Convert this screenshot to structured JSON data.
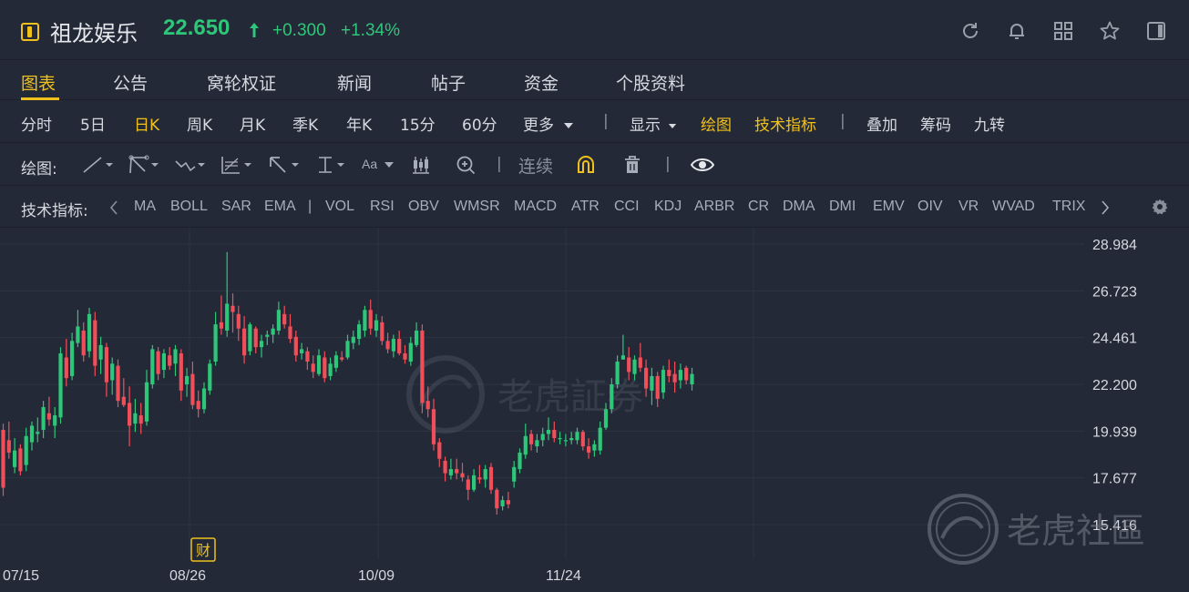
{
  "header": {
    "stock_name": "祖龙娱乐",
    "price": "22.650",
    "change": "+0.300",
    "change_pct": "+1.34%",
    "up_color": "#2ec77a",
    "down_color": "#f04f59",
    "accent": "#f0c11b",
    "icons": [
      "refresh-icon",
      "bell-icon",
      "grid-icon",
      "star-icon",
      "sidebar-icon"
    ]
  },
  "tabs": [
    {
      "label": "图表",
      "active": true
    },
    {
      "label": "公告",
      "active": false
    },
    {
      "label": "窝轮权证",
      "active": false
    },
    {
      "label": "新闻",
      "active": false
    },
    {
      "label": "帖子",
      "active": false
    },
    {
      "label": "资金",
      "active": false
    },
    {
      "label": "个股资料",
      "active": false
    }
  ],
  "periods": {
    "items": [
      "分时",
      "5日",
      "日K",
      "周K",
      "月K",
      "季K",
      "年K",
      "15分",
      "60分"
    ],
    "active": "日K",
    "more": "更多",
    "display": "显示",
    "draw": "绘图",
    "tech": "技术指标",
    "overlay": "叠加",
    "chips": "筹码",
    "nine": "九转"
  },
  "drawing": {
    "label": "绘图:",
    "continuous": "连续",
    "tools": [
      "line-tool-icon",
      "channel-tool-icon",
      "wave-tool-icon",
      "fib-tool-icon",
      "arrow-tool-icon",
      "measure-tool-icon",
      "text-tool-icon",
      "candle-tool-icon",
      "zoom-in-icon",
      "magnet-icon",
      "trash-icon",
      "eye-icon"
    ],
    "text_tool": "Aa"
  },
  "indicators": {
    "label": "技术指标:",
    "main": [
      "MA",
      "BOLL",
      "SAR",
      "EMA"
    ],
    "sub": [
      "VOL",
      "RSI",
      "OBV",
      "WMSR",
      "MACD",
      "ATR",
      "CCI",
      "KDJ",
      "ARBR",
      "CR",
      "DMA",
      "DMI",
      "EMV",
      "OIV",
      "VR",
      "WVAD",
      "TRIX"
    ],
    "icons": [
      "chevron-left-icon",
      "chevron-right-icon",
      "settings-icon"
    ]
  },
  "chart_data": {
    "type": "candlestick",
    "y_ticks": [
      "28.984",
      "26.723",
      "24.461",
      "22.200",
      "19.939",
      "17.677",
      "15.416"
    ],
    "ylim": [
      15.416,
      28.984
    ],
    "x_ticks": [
      "07/15",
      "08/26",
      "10/09",
      "11/24"
    ],
    "earnings_marker": "财",
    "watermark_center": "老虎証券",
    "watermark_corner": "老虎社區",
    "ohlc": [
      [
        20.0,
        20.3,
        16.8,
        17.2
      ],
      [
        19.5,
        20.4,
        18.6,
        18.9
      ],
      [
        18.2,
        19.6,
        17.9,
        19.0
      ],
      [
        19.1,
        19.3,
        17.8,
        18.0
      ],
      [
        18.3,
        20.1,
        18.0,
        19.7
      ],
      [
        19.4,
        20.4,
        19.0,
        20.2
      ],
      [
        19.8,
        20.6,
        19.4,
        19.9
      ],
      [
        20.0,
        21.4,
        19.6,
        21.1
      ],
      [
        20.8,
        21.6,
        20.2,
        20.5
      ],
      [
        20.2,
        21.1,
        19.6,
        20.7
      ],
      [
        20.6,
        24.0,
        20.3,
        23.7
      ],
      [
        23.5,
        24.4,
        22.1,
        22.5
      ],
      [
        22.6,
        24.7,
        22.4,
        24.3
      ],
      [
        24.2,
        25.8,
        24.0,
        25.0
      ],
      [
        24.8,
        25.2,
        23.3,
        23.6
      ],
      [
        23.8,
        25.9,
        23.5,
        25.6
      ],
      [
        25.3,
        25.7,
        22.6,
        23.1
      ],
      [
        23.4,
        24.5,
        22.7,
        24.1
      ],
      [
        24.0,
        24.2,
        21.6,
        22.3
      ],
      [
        22.4,
        23.5,
        21.7,
        23.2
      ],
      [
        23.1,
        23.4,
        21.1,
        21.4
      ],
      [
        21.6,
        22.5,
        21.1,
        21.2
      ],
      [
        21.3,
        22.1,
        19.2,
        20.2
      ],
      [
        20.3,
        21.5,
        19.9,
        20.8
      ],
      [
        20.7,
        21.3,
        19.8,
        20.3
      ],
      [
        20.4,
        22.9,
        20.2,
        22.3
      ],
      [
        22.2,
        24.1,
        22.0,
        23.9
      ],
      [
        23.8,
        24.0,
        22.4,
        22.7
      ],
      [
        22.9,
        23.9,
        22.5,
        23.7
      ],
      [
        23.6,
        24.0,
        22.9,
        23.1
      ],
      [
        23.2,
        24.1,
        22.6,
        23.9
      ],
      [
        23.7,
        23.9,
        21.4,
        21.9
      ],
      [
        22.2,
        23.0,
        21.6,
        22.6
      ],
      [
        22.7,
        23.3,
        21.0,
        21.2
      ],
      [
        21.4,
        21.9,
        20.6,
        21.0
      ],
      [
        21.0,
        22.3,
        20.8,
        22.0
      ],
      [
        21.9,
        23.4,
        21.7,
        23.2
      ],
      [
        23.3,
        25.7,
        23.1,
        25.1
      ],
      [
        25.2,
        26.5,
        24.6,
        24.9
      ],
      [
        24.8,
        28.6,
        24.5,
        26.1
      ],
      [
        26.0,
        26.6,
        24.7,
        25.7
      ],
      [
        25.6,
        26.0,
        24.3,
        24.9
      ],
      [
        24.9,
        25.5,
        23.2,
        23.6
      ],
      [
        23.8,
        25.2,
        23.6,
        25.1
      ],
      [
        24.9,
        25.0,
        23.7,
        24.0
      ],
      [
        24.0,
        24.6,
        23.5,
        24.3
      ],
      [
        24.5,
        24.8,
        24.1,
        24.6
      ],
      [
        24.6,
        25.1,
        24.2,
        24.9
      ],
      [
        24.8,
        26.2,
        24.6,
        25.8
      ],
      [
        25.6,
        26.0,
        24.9,
        25.1
      ],
      [
        25.0,
        25.6,
        24.2,
        24.4
      ],
      [
        24.5,
        24.8,
        23.3,
        23.6
      ],
      [
        23.7,
        24.2,
        23.4,
        23.9
      ],
      [
        23.8,
        24.0,
        22.9,
        23.3
      ],
      [
        23.2,
        23.6,
        22.5,
        22.8
      ],
      [
        22.7,
        23.9,
        22.6,
        23.6
      ],
      [
        23.5,
        23.8,
        22.3,
        22.5
      ],
      [
        22.6,
        23.5,
        22.4,
        23.2
      ],
      [
        23.0,
        23.8,
        22.8,
        23.6
      ],
      [
        23.5,
        23.8,
        23.3,
        23.4
      ],
      [
        23.5,
        24.6,
        23.4,
        24.3
      ],
      [
        24.2,
        24.8,
        23.9,
        24.5
      ],
      [
        24.4,
        25.3,
        24.1,
        25.1
      ],
      [
        24.8,
        26.0,
        24.5,
        25.8
      ],
      [
        25.8,
        26.3,
        24.6,
        24.9
      ],
      [
        24.8,
        25.6,
        24.5,
        25.3
      ],
      [
        25.2,
        25.5,
        24.1,
        24.3
      ],
      [
        24.3,
        24.7,
        23.7,
        23.9
      ],
      [
        23.8,
        24.6,
        23.5,
        24.4
      ],
      [
        24.4,
        24.8,
        23.6,
        23.7
      ],
      [
        23.7,
        24.1,
        23.2,
        23.4
      ],
      [
        23.3,
        24.5,
        23.1,
        24.2
      ],
      [
        24.1,
        25.2,
        24.0,
        24.8
      ],
      [
        24.8,
        25.1,
        20.8,
        21.3
      ],
      [
        21.4,
        22.1,
        20.6,
        21.0
      ],
      [
        21.0,
        21.5,
        19.0,
        19.3
      ],
      [
        19.4,
        19.6,
        18.2,
        18.6
      ],
      [
        18.5,
        18.7,
        17.5,
        17.9
      ],
      [
        17.8,
        18.6,
        17.6,
        18.1
      ],
      [
        18.1,
        18.6,
        17.6,
        17.9
      ],
      [
        17.9,
        18.4,
        17.5,
        17.7
      ],
      [
        17.6,
        17.8,
        16.6,
        17.1
      ],
      [
        17.1,
        18.1,
        17.0,
        17.8
      ],
      [
        17.7,
        18.3,
        17.4,
        17.6
      ],
      [
        17.6,
        18.3,
        17.2,
        18.1
      ],
      [
        18.2,
        18.4,
        16.9,
        17.1
      ],
      [
        17.1,
        17.2,
        15.9,
        16.2
      ],
      [
        16.3,
        16.8,
        16.1,
        16.6
      ],
      [
        16.6,
        17.0,
        16.2,
        16.4
      ],
      [
        17.5,
        18.5,
        17.2,
        18.2
      ],
      [
        18.1,
        19.1,
        17.9,
        18.9
      ],
      [
        18.8,
        20.3,
        18.6,
        19.7
      ],
      [
        19.8,
        20.0,
        19.0,
        19.3
      ],
      [
        19.2,
        19.8,
        18.9,
        19.5
      ],
      [
        19.5,
        20.1,
        19.2,
        19.8
      ],
      [
        19.8,
        20.6,
        19.5,
        20.0
      ],
      [
        20.0,
        20.4,
        19.4,
        19.6
      ],
      [
        19.6,
        19.9,
        19.3,
        19.6
      ],
      [
        19.5,
        19.8,
        19.2,
        19.5
      ],
      [
        19.5,
        19.9,
        19.3,
        19.6
      ],
      [
        19.5,
        20.1,
        19.3,
        19.9
      ],
      [
        19.9,
        20.0,
        19.0,
        19.2
      ],
      [
        19.2,
        19.6,
        18.6,
        18.9
      ],
      [
        19.0,
        19.5,
        18.7,
        19.3
      ],
      [
        19.0,
        20.4,
        18.8,
        20.1
      ],
      [
        20.1,
        21.3,
        20.0,
        21.0
      ],
      [
        21.0,
        22.5,
        20.8,
        22.2
      ],
      [
        22.2,
        23.6,
        22.0,
        23.3
      ],
      [
        23.4,
        24.6,
        23.4,
        23.6
      ],
      [
        23.5,
        24.0,
        22.4,
        22.8
      ],
      [
        22.7,
        23.6,
        22.4,
        23.4
      ],
      [
        23.5,
        24.2,
        22.8,
        23.0
      ],
      [
        23.0,
        23.4,
        21.6,
        22.0
      ],
      [
        21.9,
        23.0,
        21.2,
        22.6
      ],
      [
        22.6,
        22.8,
        21.1,
        21.5
      ],
      [
        21.8,
        23.1,
        21.5,
        22.9
      ],
      [
        22.9,
        23.4,
        22.3,
        22.6
      ],
      [
        22.7,
        23.3,
        21.8,
        22.3
      ],
      [
        22.4,
        23.2,
        22.0,
        22.9
      ],
      [
        23.0,
        23.1,
        22.2,
        22.4
      ],
      [
        22.2,
        23.0,
        21.9,
        22.7
      ]
    ]
  }
}
